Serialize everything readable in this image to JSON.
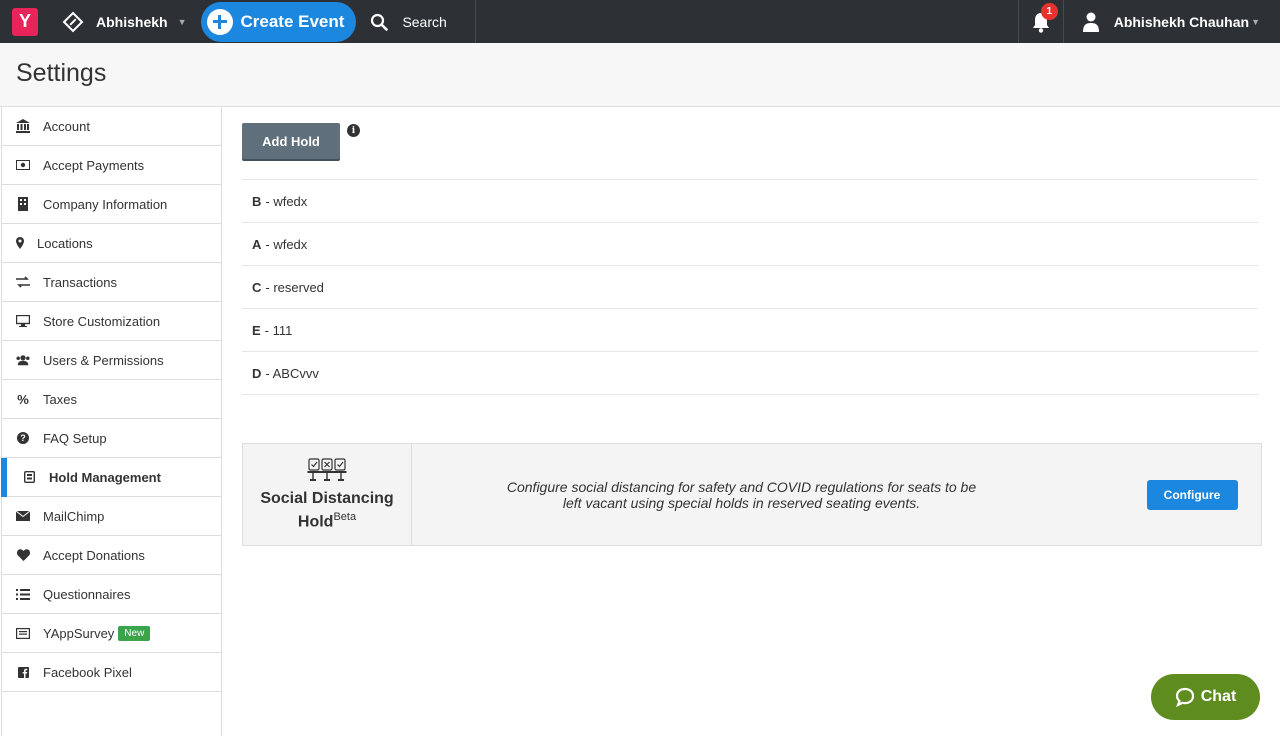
{
  "topbar": {
    "logo_letter": "Y",
    "org_name": "Abhishekh",
    "create_label": "Create Event",
    "search_label": "Search",
    "notification_count": "1",
    "user_name": "Abhishekh Chauhan"
  },
  "header": {
    "title": "Settings"
  },
  "sidebar": {
    "items": [
      {
        "label": "Account",
        "icon": "bank-icon"
      },
      {
        "label": "Accept Payments",
        "icon": "money-icon"
      },
      {
        "label": "Company Information",
        "icon": "building-icon"
      },
      {
        "label": "Locations",
        "icon": "map-marker-icon"
      },
      {
        "label": "Transactions",
        "icon": "exchange-icon"
      },
      {
        "label": "Store Customization",
        "icon": "desktop-icon"
      },
      {
        "label": "Users & Permissions",
        "icon": "users-icon"
      },
      {
        "label": "Taxes",
        "icon": "percent-icon"
      },
      {
        "label": "FAQ Setup",
        "icon": "question-circle-icon"
      },
      {
        "label": "Hold Management",
        "icon": "hold-icon",
        "active": true
      },
      {
        "label": "MailChimp",
        "icon": "envelope-icon"
      },
      {
        "label": "Accept Donations",
        "icon": "heart-icon"
      },
      {
        "label": "Questionnaires",
        "icon": "list-icon"
      },
      {
        "label": "YAppSurvey",
        "icon": "survey-icon",
        "tag": "New"
      },
      {
        "label": "Facebook Pixel",
        "icon": "facebook-icon"
      }
    ]
  },
  "main": {
    "add_hold_label": "Add Hold",
    "holds": [
      {
        "code": "B",
        "name": "- wfedx"
      },
      {
        "code": "A",
        "name": "- wfedx"
      },
      {
        "code": "C",
        "name": "- reserved"
      },
      {
        "code": "E",
        "name": "- 111"
      },
      {
        "code": "D",
        "name": "- ABCvvv"
      }
    ],
    "social_distancing": {
      "title": "Social Distancing Hold",
      "beta": "Beta",
      "description": "Configure social distancing for safety and COVID regulations for seats to be left vacant using special holds in reserved seating events.",
      "configure_label": "Configure"
    }
  },
  "chat": {
    "label": "Chat"
  },
  "colors": {
    "accent": "#1b87de",
    "topbar": "#2d3136",
    "chat": "#5f8c1e",
    "new_tag": "#3aa34b"
  }
}
